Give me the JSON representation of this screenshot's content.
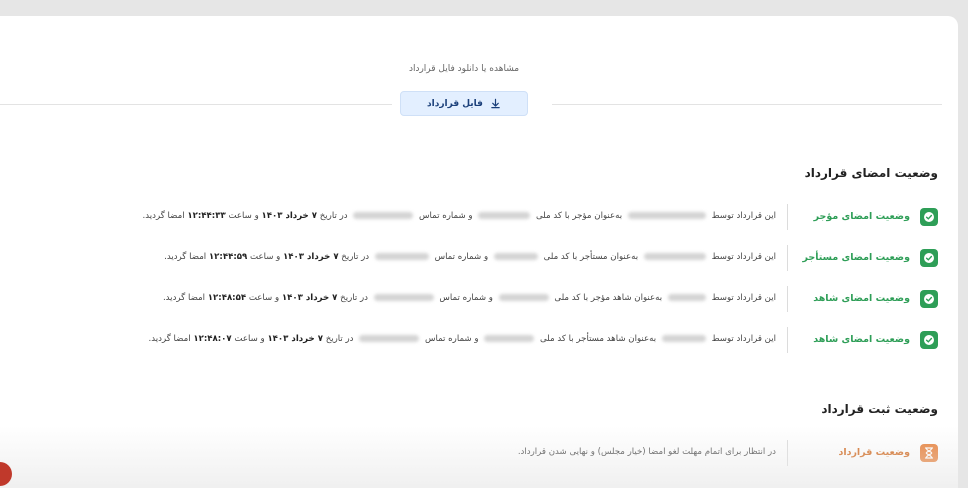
{
  "contract_file": {
    "caption": "مشاهده یا دانلود فایل قرارداد",
    "button_label": "فایل قرارداد"
  },
  "signing": {
    "title": "وضعیت امضای قرارداد",
    "rows": [
      {
        "label": "وضعیت امضای مؤجر",
        "t1": "این قرارداد توسط",
        "t2": "به‌عنوان مؤجر  با کد ملی",
        "t3": "و شماره تماس",
        "t4": "در تاریخ",
        "date": "۷ خرداد ۱۴۰۳",
        "t5": "و ساعت",
        "time": "۱۲:۴۴:۳۳",
        "t6": "امضا گردید."
      },
      {
        "label": "وضعیت امضای مستأجر",
        "t1": "این قرارداد توسط",
        "t2": "به‌عنوان مستأجر  با کد ملی",
        "t3": "و شماره تماس",
        "t4": "در تاریخ",
        "date": "۷ خرداد ۱۴۰۳",
        "t5": "و ساعت",
        "time": "۱۲:۴۴:۵۹",
        "t6": "امضا گردید."
      },
      {
        "label": "وضعیت امضای شاهد",
        "t1": "این قرارداد توسط",
        "t2": "به‌عنوان شاهد مؤجر با کد ملی",
        "t3": "و شماره تماس",
        "t4": "در تاریخ",
        "date": "۷ خرداد ۱۴۰۳",
        "t5": "و ساعت",
        "time": "۱۲:۴۸:۵۴",
        "t6": "امضا گردید."
      },
      {
        "label": "وضعیت امضای شاهد",
        "t1": "این قرارداد توسط",
        "t2": "به‌عنوان شاهد مستأجر با کد ملی",
        "t3": "و شماره تماس",
        "t4": "در تاریخ",
        "date": "۷ خرداد ۱۴۰۳",
        "t5": "و ساعت",
        "time": "۱۲:۴۸:۰۷",
        "t6": "امضا گردید."
      }
    ]
  },
  "registration": {
    "title": "وضعیت ثبت قرارداد",
    "label": "وضعیت قرارداد",
    "desc": "در انتظار برای اتمام مهلت لغو امضا (خیار مجلس) و نهایی شدن قرارداد."
  },
  "colors": {
    "success": "#2e9e57",
    "pending": "#e8803a",
    "button_bg": "#e3efff"
  },
  "icons": {
    "download": "download-arrow-icon",
    "signed": "check-circle-icon",
    "pending": "hourglass-icon"
  }
}
